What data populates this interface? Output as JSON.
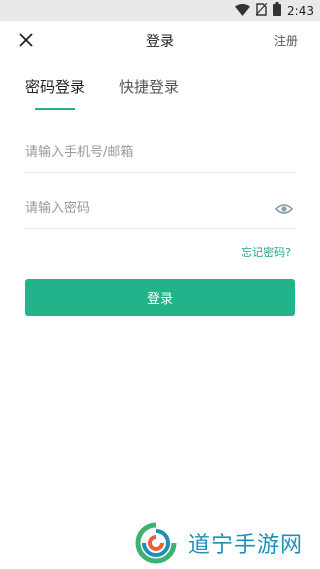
{
  "status_bar": {
    "time": "2:43",
    "icons": [
      "wifi-icon",
      "no-sim-icon",
      "battery-icon"
    ]
  },
  "header": {
    "close_icon": "close-icon",
    "title": "登录",
    "register_label": "注册"
  },
  "tabs": [
    {
      "label": "密码登录",
      "active": true
    },
    {
      "label": "快捷登录",
      "active": false
    }
  ],
  "form": {
    "account_placeholder": "请输入手机号/邮箱",
    "password_placeholder": "请输入密码",
    "password_toggle_icon": "eye-icon",
    "forgot_label": "忘记密码?",
    "submit_label": "登录"
  },
  "watermark": {
    "text": "道宁手游网",
    "logo_icon": "swirl-logo-icon"
  },
  "colors": {
    "accent": "#22b38b",
    "status_bar": "#e9e9e9",
    "watermark_text": "#1f8fb9"
  }
}
